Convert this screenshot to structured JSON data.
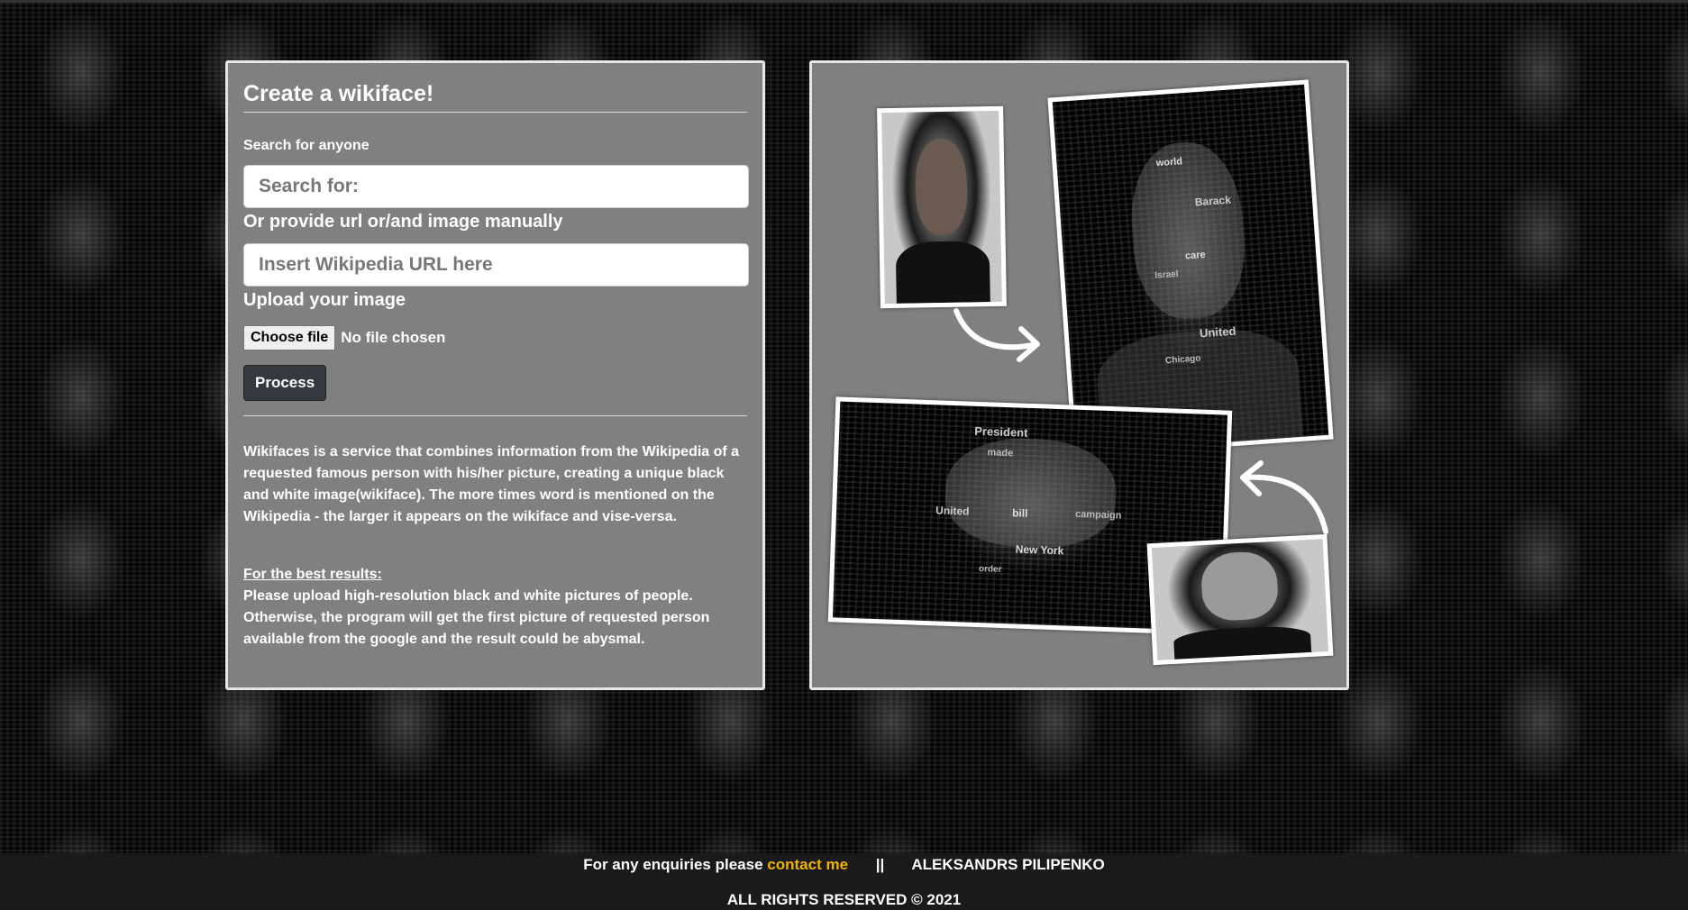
{
  "form": {
    "title": "Create a wikiface!",
    "search_label": "Search for anyone",
    "search_placeholder": "Search for:",
    "url_label": "Or provide url or/and image manually",
    "url_placeholder": "Insert Wikipedia URL here",
    "upload_label": "Upload your image",
    "file_button": "Choose file",
    "file_status": "No file chosen",
    "process_button": "Process",
    "description": "Wikifaces is a service that combines information from the Wikipedia of a requested famous person with his/her picture, creating a unique black and white image(wikiface). The more times word is mentioned on the Wikipedia - the larger it appears on the wikiface and vise-versa.",
    "best_results_title": "For the best results:",
    "best_results_text": "Please upload high-resolution black and white pictures of people. Otherwise, the program will get the first picture of requested person available from the google and the result could be abysmal."
  },
  "collage": {
    "words_top": [
      "world",
      "Barack",
      "care",
      "Israel",
      "United",
      "Chicago"
    ],
    "words_bottom": [
      "President",
      "made",
      "United",
      "bill",
      "campaign",
      "New York",
      "order"
    ]
  },
  "footer": {
    "enquiry_text": "For any enquiries please",
    "contact_link": "contact me",
    "separator": "||",
    "author": "ALEKSANDRS PILIPENKO",
    "rights": "ALL RIGHTS RESERVED © 2021"
  },
  "colors": {
    "panel": "#808080",
    "footer": "#1a1a1a",
    "link": "#f0b400"
  }
}
